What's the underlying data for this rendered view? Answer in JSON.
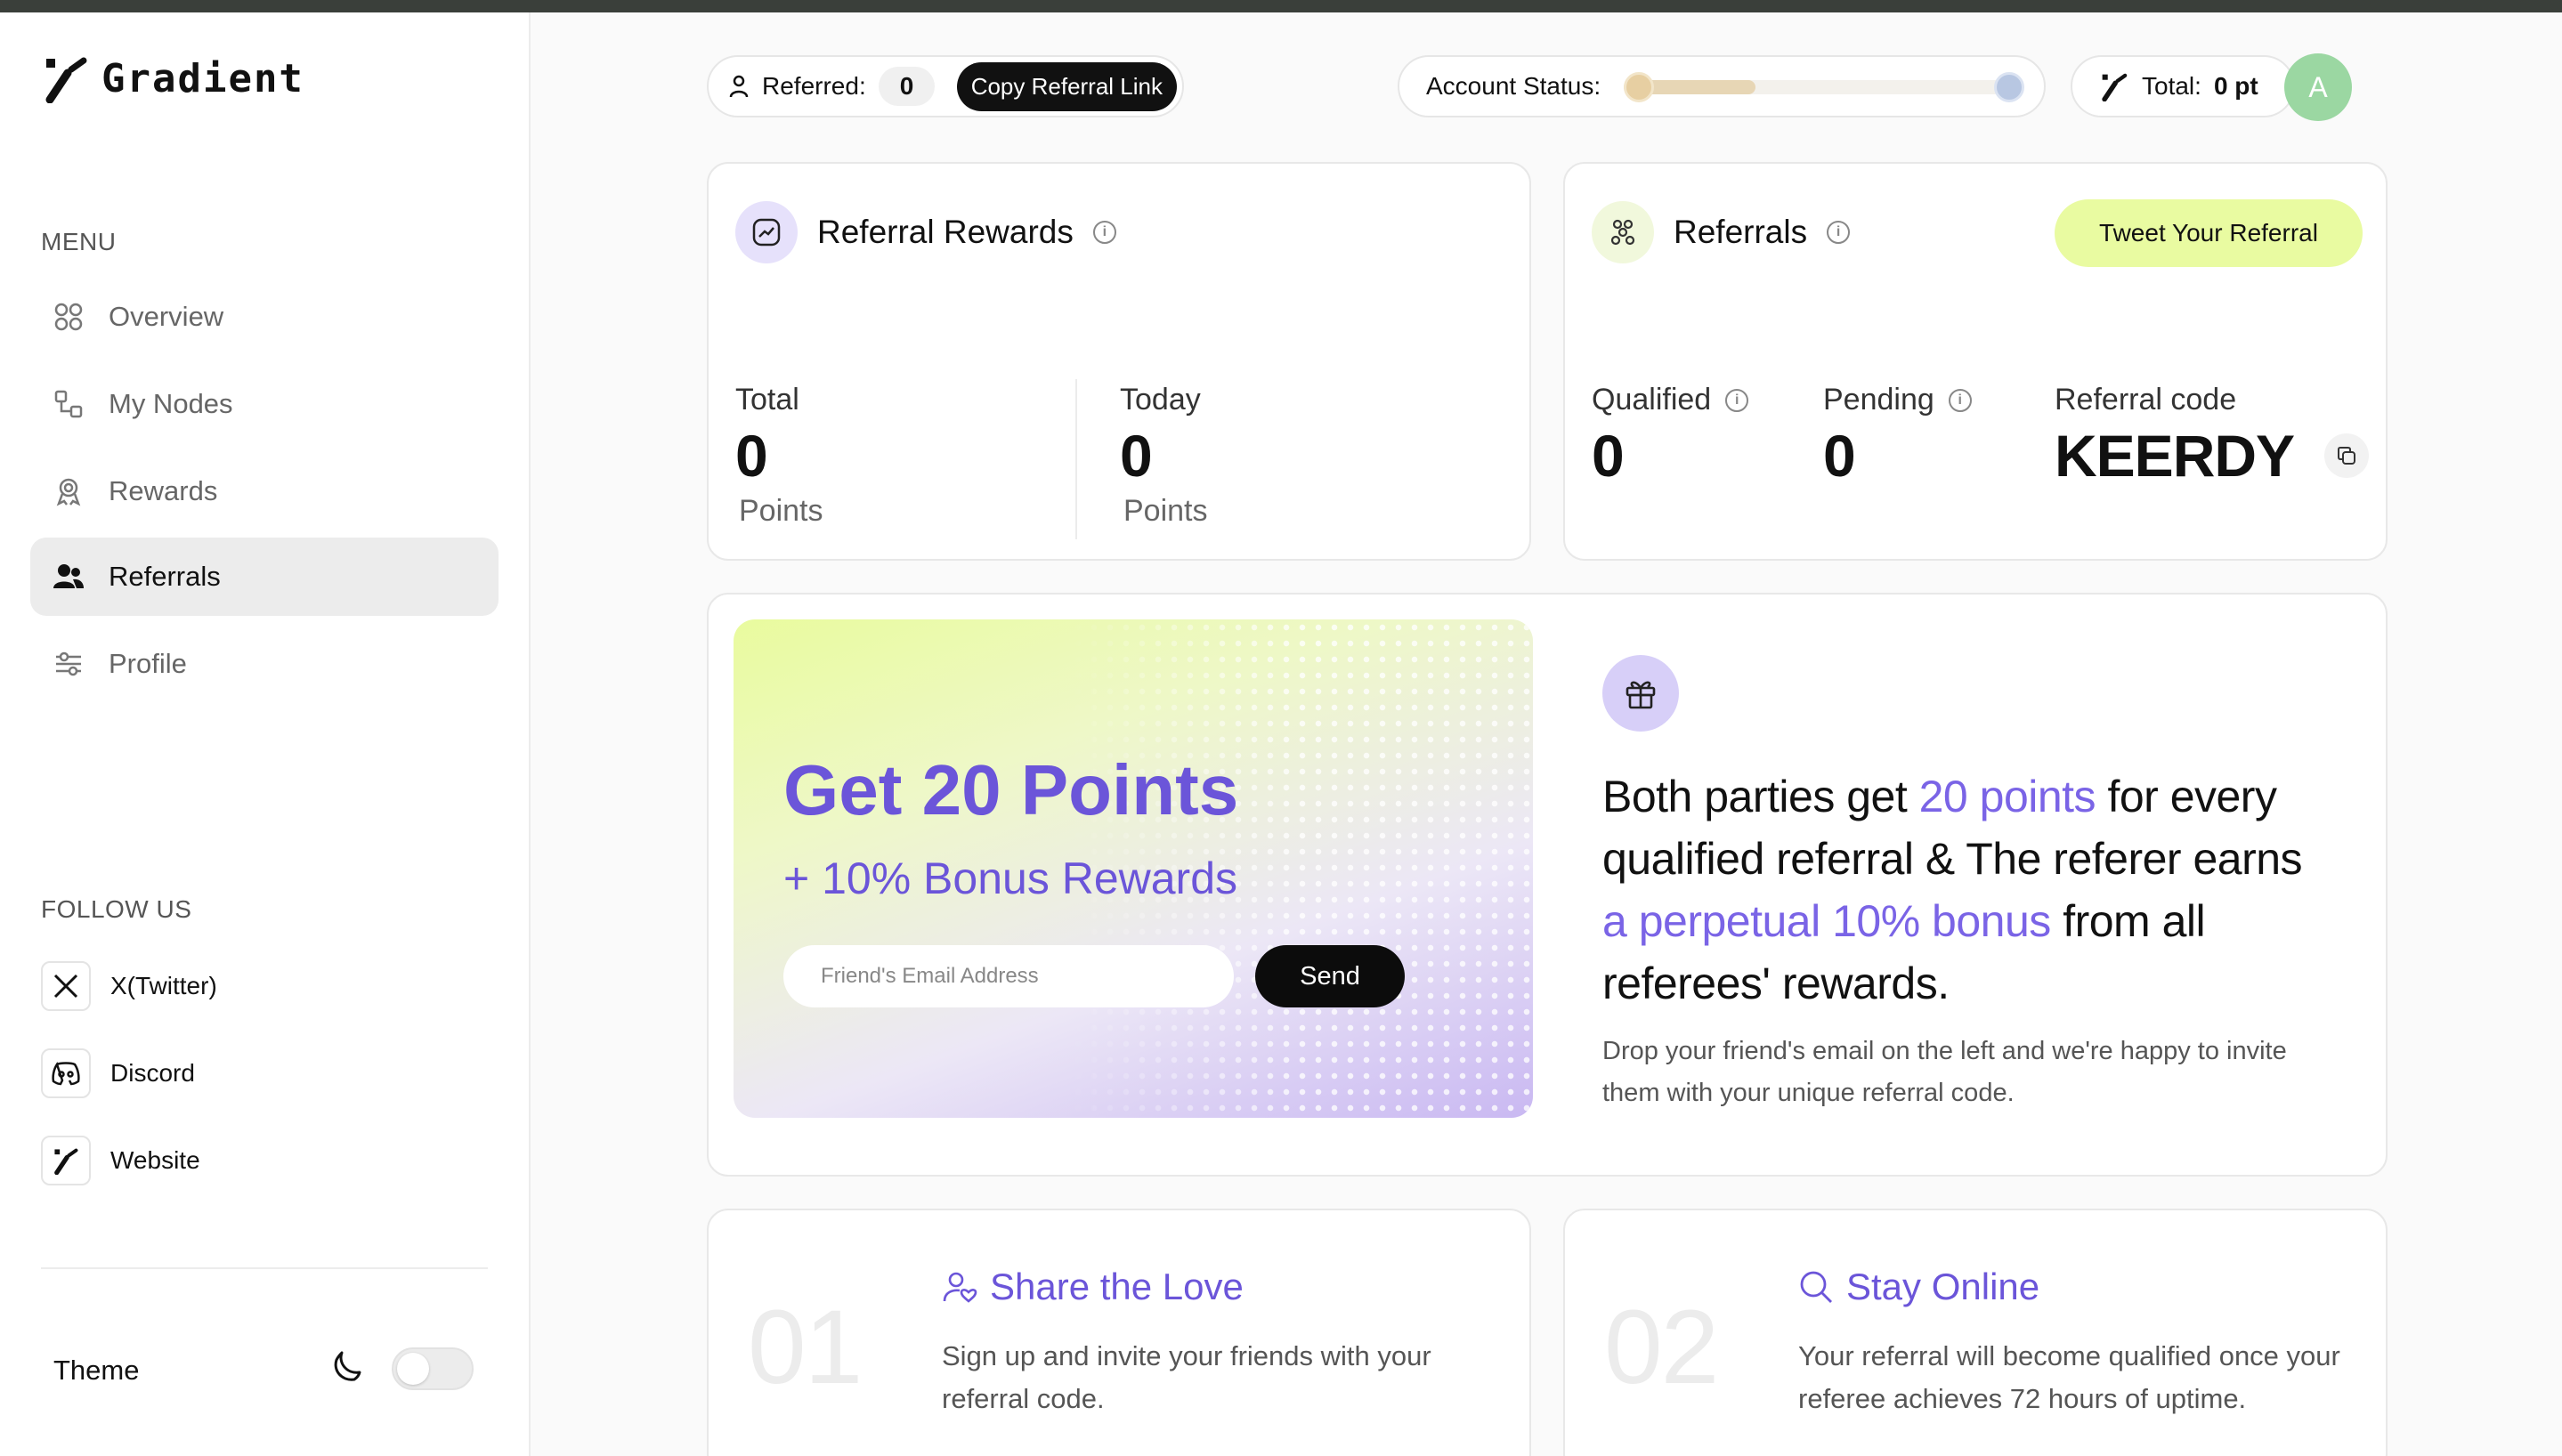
{
  "brand": {
    "name": "Gradient"
  },
  "sidebar": {
    "menu_title": "MENU",
    "items": [
      {
        "label": "Overview",
        "icon": "grid-icon"
      },
      {
        "label": "My Nodes",
        "icon": "nodes-icon"
      },
      {
        "label": "Rewards",
        "icon": "rewards-icon"
      },
      {
        "label": "Referrals",
        "icon": "users-icon",
        "active": true
      },
      {
        "label": "Profile",
        "icon": "sliders-icon"
      }
    ],
    "follow_title": "FOLLOW US",
    "social": [
      {
        "label": "X(Twitter)",
        "icon": "x-icon"
      },
      {
        "label": "Discord",
        "icon": "discord-icon"
      },
      {
        "label": "Website",
        "icon": "gradient-logo-icon"
      }
    ],
    "theme_label": "Theme"
  },
  "header": {
    "referred_label": "Referred:",
    "referred_count": "0",
    "copy_link_label": "Copy Referral Link",
    "account_status_label": "Account Status:",
    "total_label": "Total:",
    "total_value": "0 pt",
    "avatar_letter": "A"
  },
  "referral_rewards": {
    "title": "Referral Rewards",
    "total_label": "Total",
    "total_value": "0",
    "total_unit": "Points",
    "today_label": "Today",
    "today_value": "0",
    "today_unit": "Points"
  },
  "referrals": {
    "title": "Referrals",
    "tweet_label": "Tweet Your Referral",
    "qualified_label": "Qualified",
    "qualified_value": "0",
    "pending_label": "Pending",
    "pending_value": "0",
    "code_label": "Referral code",
    "code_value": "KEERDY"
  },
  "promo": {
    "title": "Get 20 Points",
    "subtitle": "+ 10% Bonus Rewards",
    "email_placeholder": "Friend's Email Address",
    "send_label": "Send",
    "desc_1": "Both parties get ",
    "desc_hl1": "20 points",
    "desc_2": " for every qualified referral & The referer earns ",
    "desc_hl2": "a perpetual 10% bonus",
    "desc_3": " from all referees' rewards.",
    "desc_small": "Drop your friend's email on the left and we're happy to invite them with your unique referral code."
  },
  "steps": [
    {
      "num": "01",
      "title": "Share the Love",
      "text": "Sign up and invite your friends with your referral code."
    },
    {
      "num": "02",
      "title": "Stay Online",
      "text": "Your referral will become qualified once your referee achieves 72 hours of uptime."
    }
  ],
  "colors": {
    "accent": "#6b55d9",
    "tweet": "#e9fba1",
    "avatar": "#9bd7a2"
  }
}
